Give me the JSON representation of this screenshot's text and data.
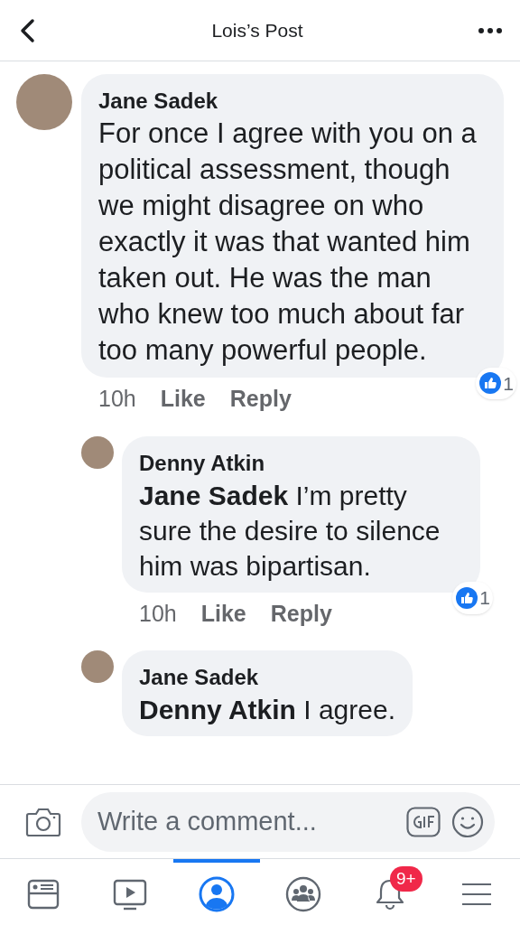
{
  "header": {
    "title": "Lois’s Post"
  },
  "comments": [
    {
      "author": "Jane Sadek",
      "text": "For once I agree with you on a political assessment, though we might disagree on who exactly it was that wanted him taken out.  He was the man who knew too much about far too many powerful people.",
      "time": "10h",
      "actions": [
        "Like",
        "Reply"
      ],
      "reactions": "1",
      "children": [
        {
          "author": "Denny Atkin",
          "text": "**Jane Sadek** I’m pretty sure the desire to silence him was bipartisan.",
          "time": "10h",
          "actions": [
            "Like",
            "Reply"
          ],
          "reactions": "1"
        },
        {
          "author": "Jane Sadek",
          "text": "**Denny Atkin** I agree."
        }
      ]
    }
  ],
  "composer": {
    "placeholder": "Write a comment..."
  },
  "tabs": [
    {
      "kind": "feed",
      "selected": false
    },
    {
      "kind": "watch",
      "selected": false
    },
    {
      "kind": "profile",
      "selected": true
    },
    {
      "kind": "groups",
      "selected": false
    },
    {
      "kind": "notifications",
      "selected": false,
      "badge": "9+"
    },
    {
      "kind": "menu",
      "selected": false
    }
  ]
}
